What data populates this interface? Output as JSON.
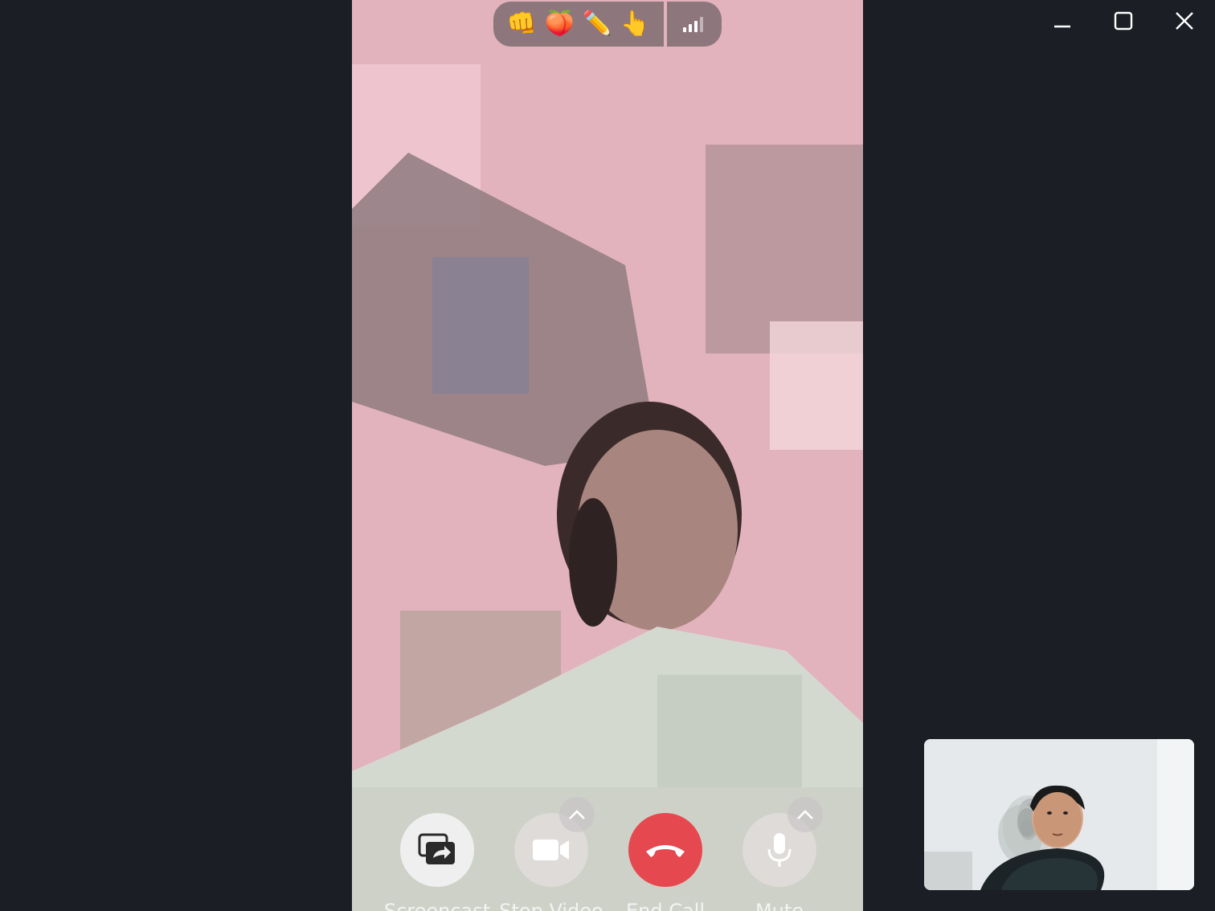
{
  "window_controls": {
    "minimize_icon": "minimize-icon",
    "maximize_icon": "maximize-icon",
    "close_icon": "close-icon"
  },
  "reactions": [
    "👊",
    "🍑",
    "✏️",
    "👆"
  ],
  "signal_icon": "signal-strength-icon",
  "controls": {
    "screencast_label": "Screencast",
    "video_label": "Stop Video",
    "end_call_label": "End Call",
    "mute_label": "Mute"
  },
  "colors": {
    "background": "#1b1e24",
    "end_call": "#e5484f"
  }
}
